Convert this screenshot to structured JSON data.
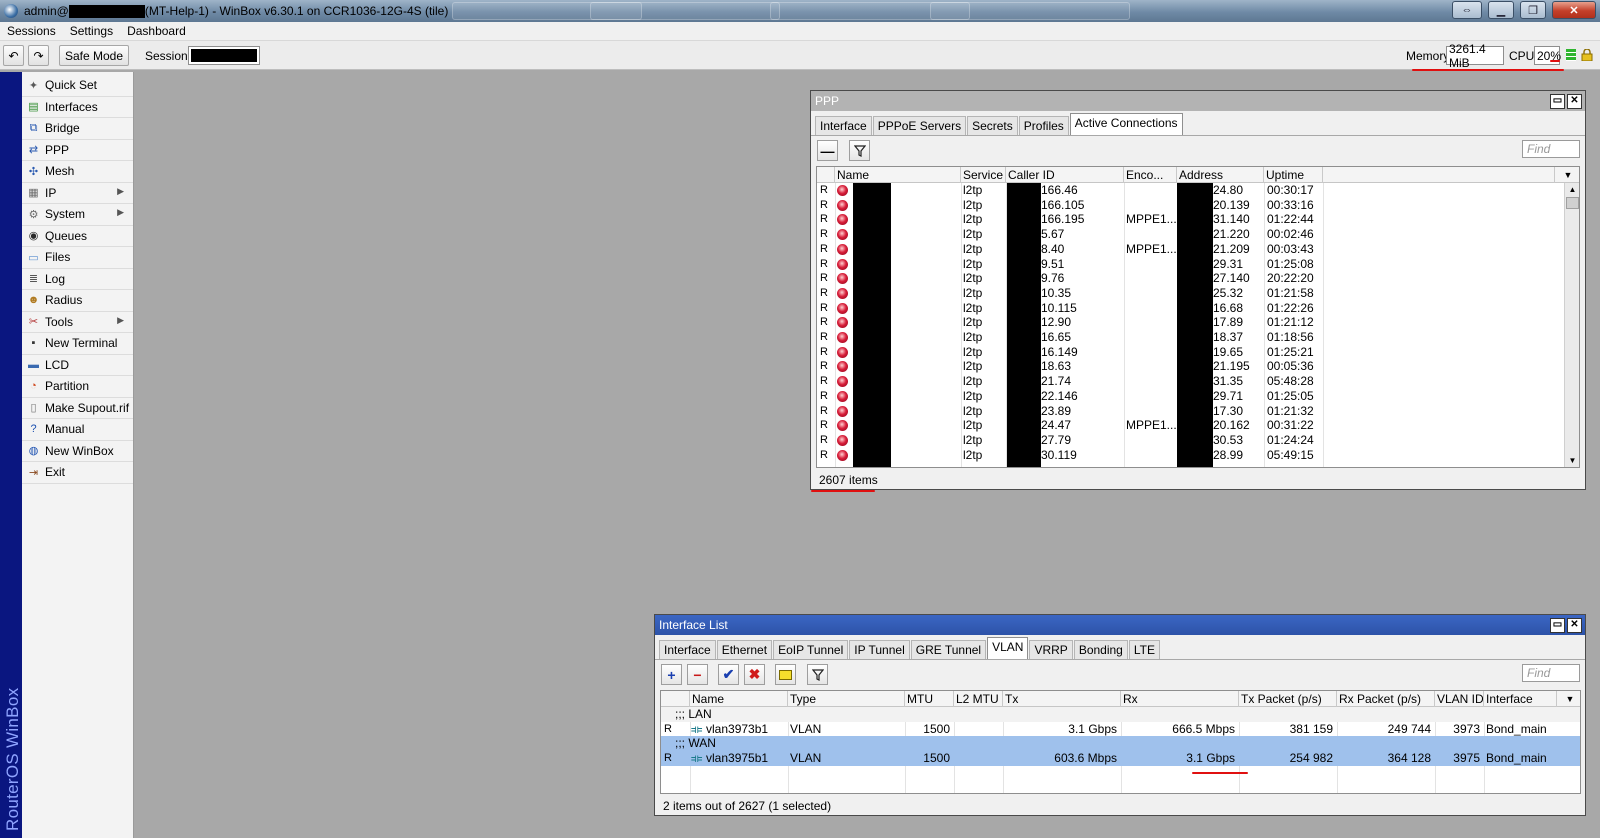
{
  "titlebar": {
    "prefix": "admin@",
    "suffix": "(MT-Help-1) - WinBox v6.30.1 on CCR1036-12G-4S (tile)"
  },
  "menu": [
    "Sessions",
    "Settings",
    "Dashboard"
  ],
  "toolbar": {
    "safe_mode": "Safe Mode",
    "session_label": "Session:",
    "memory_label": "Memory:",
    "memory_value": "3261.4 MiB",
    "cpu_label": "CPU:",
    "cpu_value": "20%"
  },
  "brand": "RouterOS WinBox",
  "sidebar": {
    "items": [
      {
        "label": "Quick Set",
        "icon": "wand-icon",
        "sub": false
      },
      {
        "label": "Interfaces",
        "icon": "interfaces-icon",
        "sub": false
      },
      {
        "label": "Bridge",
        "icon": "bridge-icon",
        "sub": false
      },
      {
        "label": "PPP",
        "icon": "ppp-icon",
        "sub": false
      },
      {
        "label": "Mesh",
        "icon": "mesh-icon",
        "sub": false
      },
      {
        "label": "IP",
        "icon": "ip-icon",
        "sub": true
      },
      {
        "label": "System",
        "icon": "gear-icon",
        "sub": true
      },
      {
        "label": "Queues",
        "icon": "queues-icon",
        "sub": false
      },
      {
        "label": "Files",
        "icon": "folder-icon",
        "sub": false
      },
      {
        "label": "Log",
        "icon": "log-icon",
        "sub": false
      },
      {
        "label": "Radius",
        "icon": "users-icon",
        "sub": false
      },
      {
        "label": "Tools",
        "icon": "tools-icon",
        "sub": true
      },
      {
        "label": "New Terminal",
        "icon": "terminal-icon",
        "sub": false
      },
      {
        "label": "LCD",
        "icon": "lcd-icon",
        "sub": false
      },
      {
        "label": "Partition",
        "icon": "pie-icon",
        "sub": false
      },
      {
        "label": "Make Supout.rif",
        "icon": "document-icon",
        "sub": false
      },
      {
        "label": "Manual",
        "icon": "help-icon",
        "sub": false
      },
      {
        "label": "New WinBox",
        "icon": "globe-icon",
        "sub": false
      },
      {
        "label": "Exit",
        "icon": "exit-icon",
        "sub": false
      }
    ]
  },
  "ppp": {
    "title": "PPP",
    "tabs": [
      "Interface",
      "PPPoE Servers",
      "Secrets",
      "Profiles",
      "Active Connections"
    ],
    "selected_tab": 4,
    "find_placeholder": "Find",
    "columns": [
      "Name",
      "Service",
      "Caller ID",
      "Enco...",
      "Address",
      "Uptime"
    ],
    "rows": [
      {
        "flag": "R",
        "service": "l2tp",
        "caller": "166.46",
        "enc": "",
        "addr": "24.80",
        "uptime": "00:30:17"
      },
      {
        "flag": "R",
        "service": "l2tp",
        "caller": "166.105",
        "enc": "",
        "addr": "20.139",
        "uptime": "00:33:16"
      },
      {
        "flag": "R",
        "service": "l2tp",
        "caller": "166.195",
        "enc": "MPPE1...",
        "addr": "31.140",
        "uptime": "01:22:44"
      },
      {
        "flag": "R",
        "service": "l2tp",
        "caller": "5.67",
        "enc": "",
        "addr": "21.220",
        "uptime": "00:02:46"
      },
      {
        "flag": "R",
        "service": "l2tp",
        "caller": "8.40",
        "enc": "MPPE1...",
        "addr": "21.209",
        "uptime": "00:03:43"
      },
      {
        "flag": "R",
        "service": "l2tp",
        "caller": "9.51",
        "enc": "",
        "addr": "29.31",
        "uptime": "01:25:08"
      },
      {
        "flag": "R",
        "service": "l2tp",
        "caller": "9.76",
        "enc": "",
        "addr": "27.140",
        "uptime": "20:22:20"
      },
      {
        "flag": "R",
        "service": "l2tp",
        "caller": "10.35",
        "enc": "",
        "addr": "25.32",
        "uptime": "01:21:58"
      },
      {
        "flag": "R",
        "service": "l2tp",
        "caller": "10.115",
        "enc": "",
        "addr": "16.68",
        "uptime": "01:22:26"
      },
      {
        "flag": "R",
        "service": "l2tp",
        "caller": "12.90",
        "enc": "",
        "addr": "17.89",
        "uptime": "01:21:12"
      },
      {
        "flag": "R",
        "service": "l2tp",
        "caller": "16.65",
        "enc": "",
        "addr": "18.37",
        "uptime": "01:18:56"
      },
      {
        "flag": "R",
        "service": "l2tp",
        "caller": "16.149",
        "enc": "",
        "addr": "19.65",
        "uptime": "01:25:21"
      },
      {
        "flag": "R",
        "service": "l2tp",
        "caller": "18.63",
        "enc": "",
        "addr": "21.195",
        "uptime": "00:05:36"
      },
      {
        "flag": "R",
        "service": "l2tp",
        "caller": "21.74",
        "enc": "",
        "addr": "31.35",
        "uptime": "05:48:28"
      },
      {
        "flag": "R",
        "service": "l2tp",
        "caller": "22.146",
        "enc": "",
        "addr": "29.71",
        "uptime": "01:25:05"
      },
      {
        "flag": "R",
        "service": "l2tp",
        "caller": "23.89",
        "enc": "",
        "addr": "17.30",
        "uptime": "01:21:32"
      },
      {
        "flag": "R",
        "service": "l2tp",
        "caller": "24.47",
        "enc": "MPPE1...",
        "addr": "20.162",
        "uptime": "00:31:22"
      },
      {
        "flag": "R",
        "service": "l2tp",
        "caller": "27.79",
        "enc": "",
        "addr": "30.53",
        "uptime": "01:24:24"
      },
      {
        "flag": "R",
        "service": "l2tp",
        "caller": "30.119",
        "enc": "",
        "addr": "28.99",
        "uptime": "05:49:15"
      }
    ],
    "status": "2607 items"
  },
  "iflist": {
    "title": "Interface List",
    "tabs": [
      "Interface",
      "Ethernet",
      "EoIP Tunnel",
      "IP Tunnel",
      "GRE Tunnel",
      "VLAN",
      "VRRP",
      "Bonding",
      "LTE"
    ],
    "selected_tab": 5,
    "find_placeholder": "Find",
    "columns": [
      "Name",
      "Type",
      "MTU",
      "L2 MTU",
      "Tx",
      "Rx",
      "Tx Packet (p/s)",
      "Rx Packet (p/s)",
      "VLAN ID",
      "Interface"
    ],
    "groups": [
      {
        "label": ";;; LAN",
        "row": {
          "flag": "R",
          "name": "vlan3973b1",
          "type": "VLAN",
          "mtu": "1500",
          "l2mtu": "",
          "tx": "3.1 Gbps",
          "rx": "666.5 Mbps",
          "txp": "381 159",
          "rxp": "249 744",
          "vlan": "3973",
          "iface": "Bond_main"
        }
      },
      {
        "label": ";;; WAN",
        "row": {
          "flag": "R",
          "name": "vlan3975b1",
          "type": "VLAN",
          "mtu": "1500",
          "l2mtu": "",
          "tx": "603.6 Mbps",
          "rx": "3.1 Gbps",
          "txp": "254 982",
          "rxp": "364 128",
          "vlan": "3975",
          "iface": "Bond_main"
        }
      }
    ],
    "status": "2 items out of 2627 (1 selected)"
  },
  "colors": {
    "brand_strip": "#0a1680",
    "active_title": "#2d53a8",
    "selected_row": "#9fc1ec",
    "annotation": "#e01010"
  }
}
